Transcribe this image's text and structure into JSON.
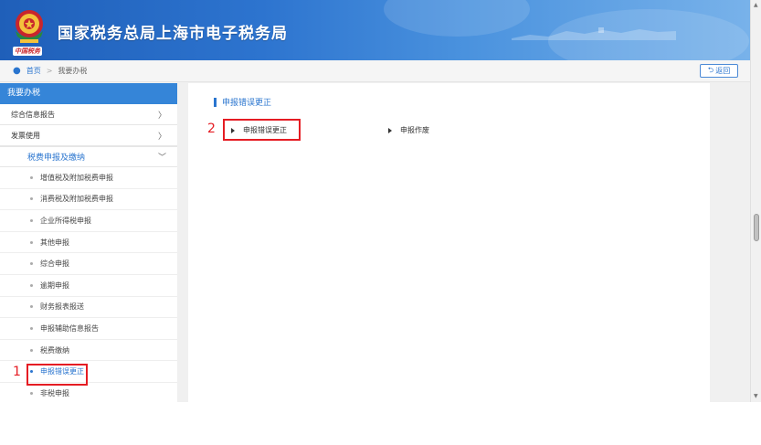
{
  "header": {
    "title": "国家税务总局上海市电子税务局",
    "emblem_text": "中国税务",
    "emblem_icon": "tax-emblem-icon",
    "colors": {
      "gradient_start": "#1f5fb9",
      "gradient_end": "#78b2ea"
    }
  },
  "breadcrumb": {
    "home": "首页",
    "separator": ">",
    "current": "我要办税",
    "back_label": "返回"
  },
  "sidebar": {
    "title": "我要办税",
    "categories": [
      {
        "label": "综合信息报告",
        "arrow": "〉"
      },
      {
        "label": "发票使用",
        "arrow": "〉"
      }
    ],
    "open_category": {
      "label": "税费申报及缴纳",
      "arrow": "﹀"
    },
    "items": [
      {
        "label": "增值税及附加税费申报"
      },
      {
        "label": "消费税及附加税费申报"
      },
      {
        "label": "企业所得税申报"
      },
      {
        "label": "其他申报"
      },
      {
        "label": "综合申报"
      },
      {
        "label": "逾期申报"
      },
      {
        "label": "财务报表报送"
      },
      {
        "label": "申报辅助信息报告"
      },
      {
        "label": "税费缴纳"
      },
      {
        "label": "申报错误更正"
      },
      {
        "label": "非税申报"
      }
    ],
    "active_index": 9
  },
  "main": {
    "title": "申报错误更正",
    "links": [
      {
        "label": "申报错误更正"
      },
      {
        "label": "申报作废"
      }
    ]
  },
  "annotations": [
    {
      "number": "1",
      "color": "#e51c23"
    },
    {
      "number": "2",
      "color": "#e51c23"
    }
  ]
}
